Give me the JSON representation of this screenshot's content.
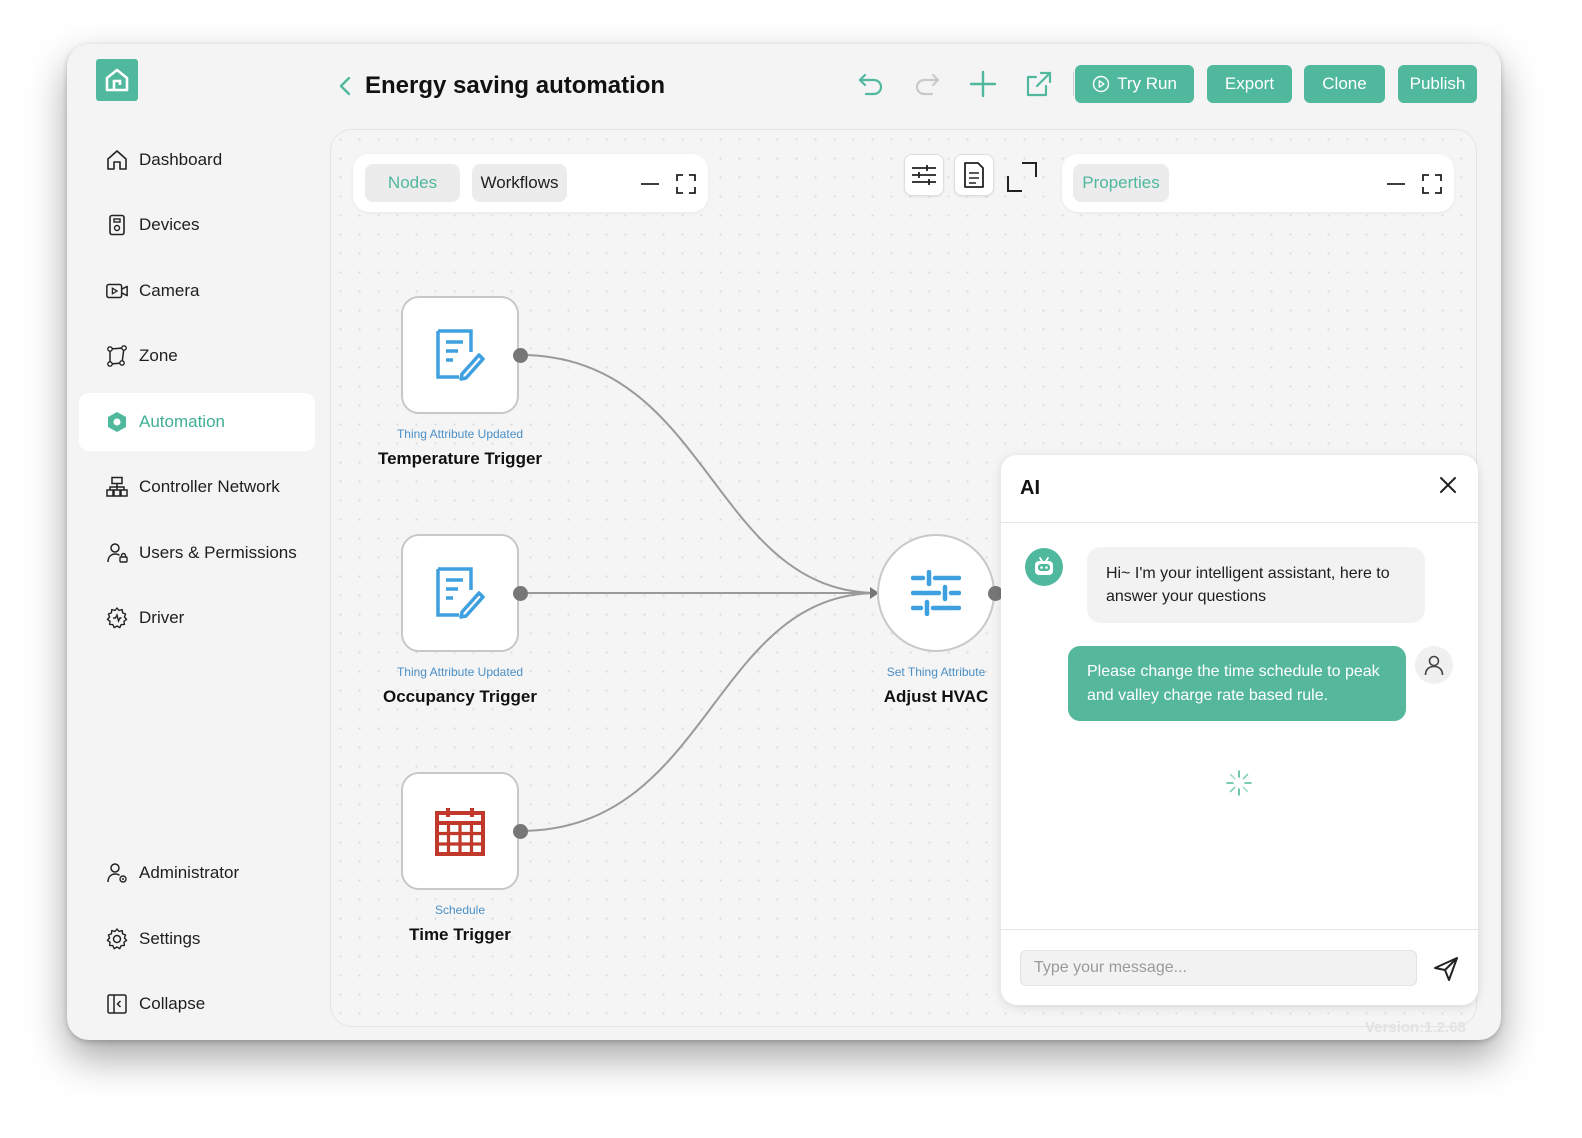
{
  "header": {
    "title": "Energy saving automation",
    "buttons": {
      "try_run": "Try Run",
      "export": "Export",
      "clone": "Clone",
      "publish": "Publish"
    }
  },
  "sidebar": {
    "items": [
      {
        "label": "Dashboard",
        "icon": "home-icon"
      },
      {
        "label": "Devices",
        "icon": "device-icon"
      },
      {
        "label": "Camera",
        "icon": "camera-icon"
      },
      {
        "label": "Zone",
        "icon": "zone-icon"
      },
      {
        "label": "Automation",
        "icon": "automation-icon",
        "active": true
      },
      {
        "label": "Controller Network",
        "icon": "network-icon"
      },
      {
        "label": "Users & Permissions",
        "icon": "users-icon"
      },
      {
        "label": "Driver",
        "icon": "driver-icon"
      }
    ],
    "bottom": [
      {
        "label": "Administrator",
        "icon": "admin-icon"
      },
      {
        "label": "Settings",
        "icon": "gear-icon"
      },
      {
        "label": "Collapse",
        "icon": "collapse-icon"
      }
    ]
  },
  "left_panel": {
    "tabs": [
      "Nodes",
      "Workflows"
    ]
  },
  "right_panel": {
    "tab": "Properties"
  },
  "nodes": [
    {
      "type": "Thing Attribute Updated",
      "name": "Temperature Trigger"
    },
    {
      "type": "Thing Attribute Updated",
      "name": "Occupancy Trigger"
    },
    {
      "type": "Schedule",
      "name": "Time Trigger"
    },
    {
      "type": "Set Thing Attribute",
      "name": "Adjust HVAC"
    }
  ],
  "ai": {
    "title": "AI",
    "messages": [
      {
        "role": "assistant",
        "text": "Hi~ I'm your intelligent assistant, here to answer your questions"
      },
      {
        "role": "user",
        "text": "Please change the time schedule to peak and valley charge rate based rule."
      }
    ],
    "input_placeholder": "Type your message..."
  },
  "version": "Version:1.2.68",
  "colors": {
    "accent": "#4fb89d",
    "node_icon_blue": "#3fa0e0",
    "schedule_red": "#c0392b"
  }
}
